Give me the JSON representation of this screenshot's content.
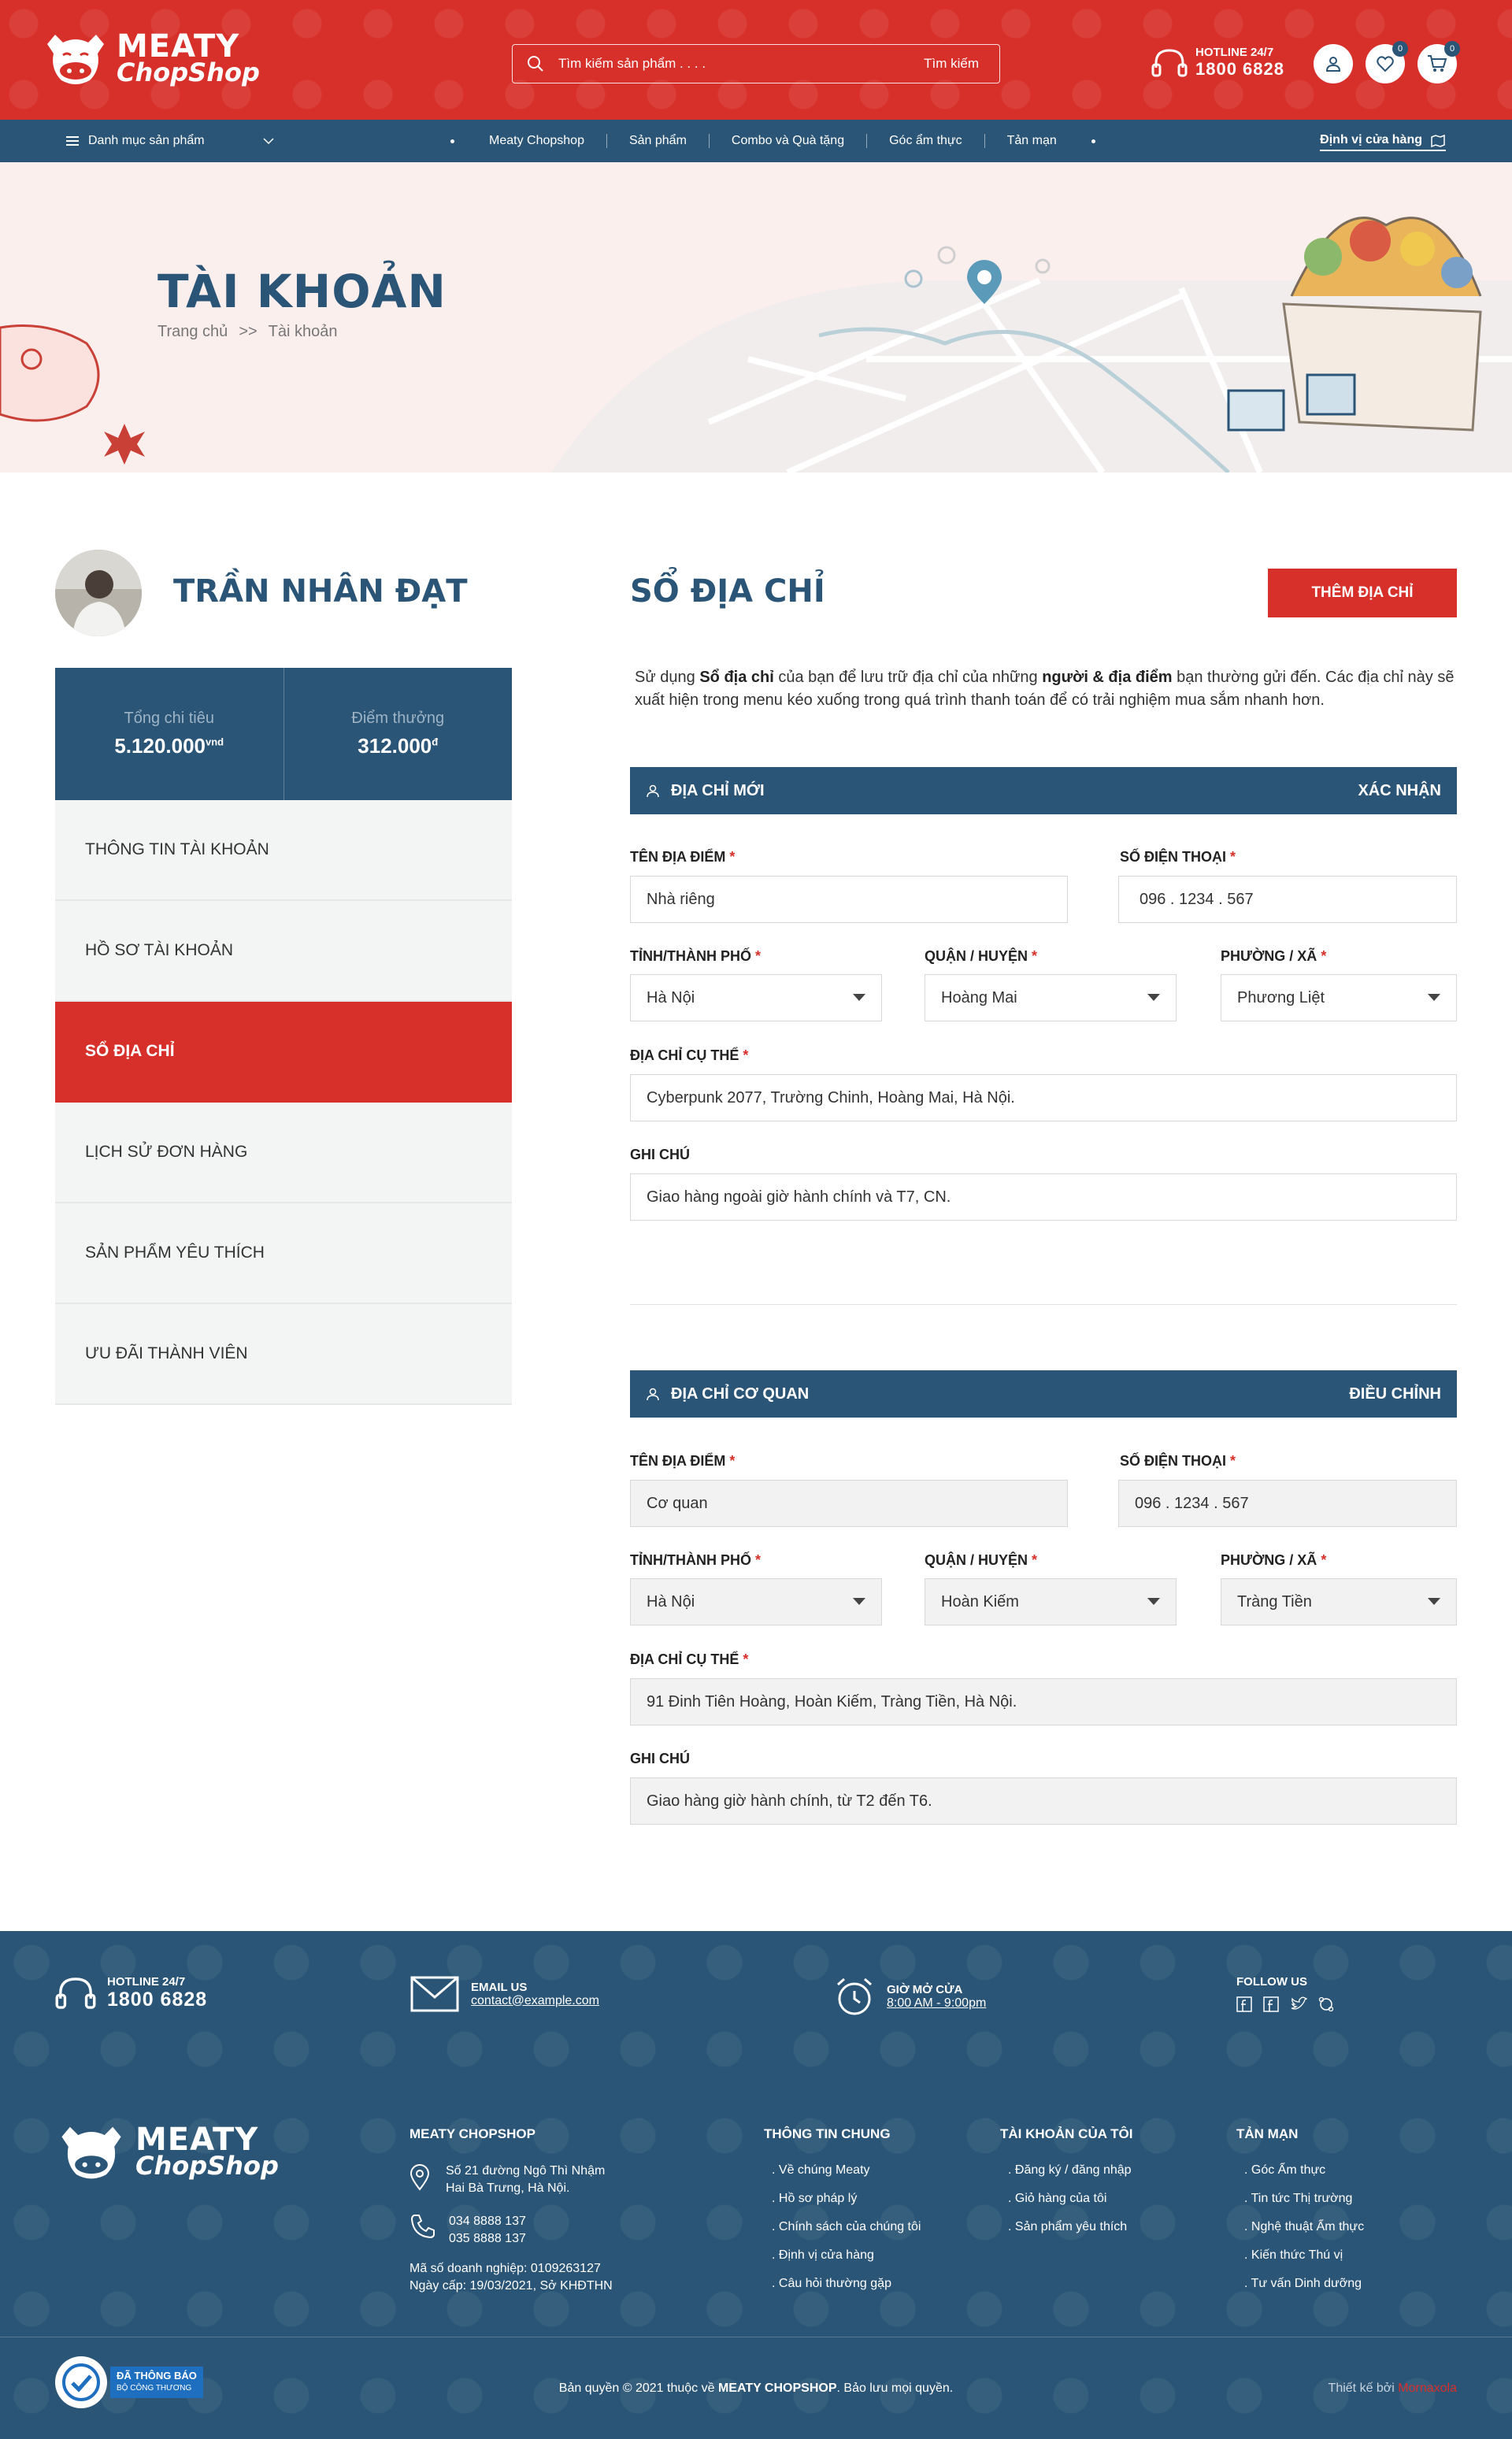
{
  "header": {
    "logo_line1": "MEATY",
    "logo_line2": "ChopShop",
    "search_placeholder": "Tìm kiếm sản phẩm . . . .",
    "search_button": "Tìm kiếm",
    "hotline_label": "HOTLINE 24/7",
    "hotline_number": "1800 6828",
    "wishlist_count": "0",
    "cart_count": "0"
  },
  "nav": {
    "categories": "Danh mục sản phẩm",
    "items": [
      "Meaty Chopshop",
      "Sản phẩm",
      "Combo và Quà tặng",
      "Góc ẩm thực",
      "Tản mạn"
    ],
    "locate_store": "Định vị cửa hàng"
  },
  "banner": {
    "title": "TÀI KHOẢN",
    "breadcrumb_home": "Trang chủ",
    "breadcrumb_sep": ">>",
    "breadcrumb_current": "Tài khoản"
  },
  "profile": {
    "name": "TRẦN NHÂN ĐẠT",
    "total_spent_label": "Tổng chi tiêu",
    "total_spent_value": "5.120.000",
    "total_spent_unit": "vnd",
    "points_label": "Điểm thưởng",
    "points_value": "312.000",
    "points_unit": "đ"
  },
  "side_menu": [
    "THÔNG TIN TÀI KHOẢN",
    "HỒ SƠ TÀI KHOẢN",
    "SỔ ĐỊA CHỈ",
    "LỊCH SỬ ĐƠN HÀNG",
    "SẢN PHẨM YÊU THÍCH",
    "ƯU ĐÃI THÀNH VIÊN"
  ],
  "main": {
    "title": "SỔ ĐỊA CHỈ",
    "add_button": "THÊM ĐỊA CHỈ",
    "intro_1": "Sử dụng ",
    "intro_b1": "Sổ địa chỉ",
    "intro_2": " của bạn để lưu trữ địa chỉ của những ",
    "intro_b2": "người & địa điểm",
    "intro_3": " bạn thường gửi đến. Các địa chỉ này sẽ xuất hiện trong menu kéo xuống trong quá trình thanh toán để có trải nghiệm mua sắm nhanh hơn."
  },
  "labels": {
    "place_name": "TÊN ĐỊA ĐIỂM",
    "phone": "SỐ ĐIỆN THOẠI",
    "city": "TỈNH/THÀNH PHỐ",
    "district": "QUẬN / HUYỆN",
    "ward": "PHƯỜNG / XÃ",
    "address": "ĐỊA CHỈ CỤ THỂ",
    "note": "GHI CHÚ",
    "required": "*"
  },
  "address_new": {
    "header": "ĐỊA CHỈ MỚI",
    "action": "XÁC NHẬN",
    "place_name": "Nhà riêng",
    "phone": "096 . 1234 . 567",
    "city": "Hà Nội",
    "district": "Hoàng Mai",
    "ward": "Phương Liệt",
    "address": "Cyberpunk 2077, Trường Chinh, Hoàng Mai, Hà Nội.",
    "note": "Giao hàng ngoài giờ hành chính và T7, CN."
  },
  "address_office": {
    "header": "ĐỊA CHỈ CƠ QUAN",
    "action": "ĐIỀU CHỈNH",
    "place_name": "Cơ quan",
    "phone": "096 . 1234 . 567",
    "city": "Hà Nội",
    "district": "Hoàn Kiếm",
    "ward": "Tràng Tiền",
    "address": "91 Đinh Tiên Hoàng, Hoàn Kiếm, Tràng Tiền, Hà Nội.",
    "note": "Giao hàng giờ hành chính, từ T2 đến T6."
  },
  "footer": {
    "hotline_label": "HOTLINE 24/7",
    "hotline_number": "1800 6828",
    "email_label": "EMAIL US",
    "email_value": "contact@example.com",
    "hours_label": "GIỜ MỞ CỬA",
    "hours_value": "8:00 AM - 9:00pm",
    "follow_label": "FOLLOW US",
    "company_heading": "MEATY CHOPSHOP",
    "address_line1": "Số 21 đường Ngô Thì Nhậm",
    "address_line2": "Hai Bà Trưng, Hà Nội.",
    "phone1": "034 8888 137",
    "phone2": "035 8888 137",
    "business_code": "Mã số doanh nghiệp: 0109263127",
    "issued": "Ngày cấp: 19/03/2021, Sở KHĐTHN",
    "col1_heading": "THÔNG TIN CHUNG",
    "col1_items": [
      "Về chúng Meaty",
      "Hồ sơ pháp lý",
      "Chính sách của chúng tôi",
      "Định vị cửa hàng",
      "Câu hỏi thường gặp"
    ],
    "col2_heading": "TÀI KHOẢN CỦA TÔI",
    "col2_items": [
      "Đăng ký / đăng nhập",
      "Giỏ hàng của tôi",
      "Sản phẩm yêu thích"
    ],
    "col3_heading": "TẢN MẠN",
    "col3_items": [
      "Góc Ẩm thực",
      "Tin tức Thị trường",
      "Nghệ thuật Ẩm thực",
      "Kiến thức Thú vị",
      "Tư vấn Dinh dưỡng"
    ],
    "badge_line1": "ĐÃ THÔNG BÁO",
    "badge_line2": "BỘ CÔNG THƯƠNG",
    "copyright_1": "Bản quyền © 2021 thuộc về ",
    "copyright_brand": "MEATY CHOPSHOP",
    "copyright_2": ". Bảo lưu mọi quyền.",
    "designer_label": "Thiết kế bởi ",
    "designer_name": "Mornaxola"
  },
  "colors": {
    "brand_red": "#d7302a",
    "brand_blue": "#2b5576"
  }
}
